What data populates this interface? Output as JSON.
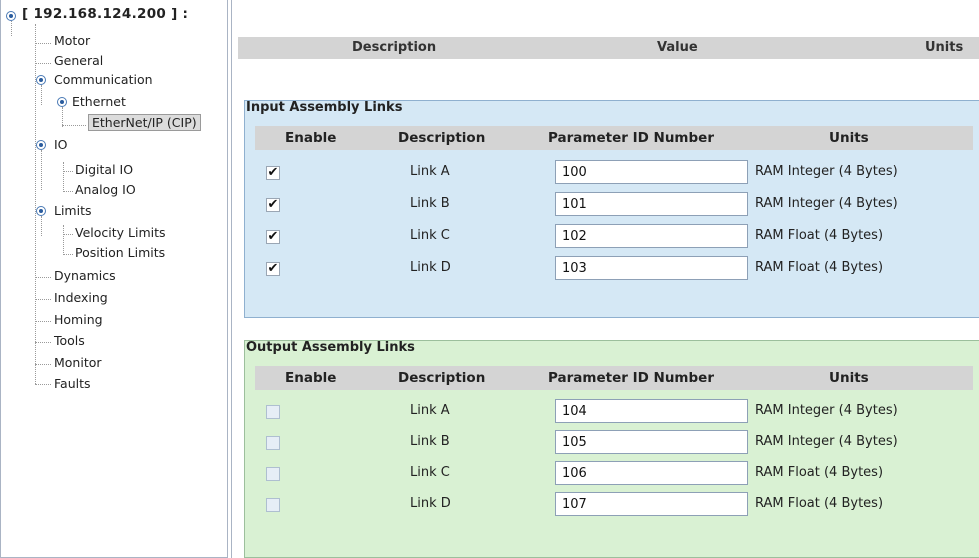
{
  "tree": {
    "root_label": "[ 192.168.124.200 ]  :",
    "items": [
      {
        "label": "Motor"
      },
      {
        "label": "General"
      },
      {
        "label": "Communication"
      },
      {
        "label": "Ethernet"
      },
      {
        "label": "EtherNet/IP (CIP)"
      },
      {
        "label": "IO"
      },
      {
        "label": "Digital IO"
      },
      {
        "label": "Analog IO"
      },
      {
        "label": "Limits"
      },
      {
        "label": "Velocity Limits"
      },
      {
        "label": "Position Limits"
      },
      {
        "label": "Dynamics"
      },
      {
        "label": "Indexing"
      },
      {
        "label": "Homing"
      },
      {
        "label": "Tools"
      },
      {
        "label": "Monitor"
      },
      {
        "label": "Faults"
      }
    ]
  },
  "main": {
    "header": {
      "description": "Description",
      "value": "Value",
      "units": "Units"
    },
    "input_panel": {
      "title": "Input Assembly Links",
      "columns": {
        "enable": "Enable",
        "description": "Description",
        "param": "Parameter ID Number",
        "units": "Units"
      },
      "rows": [
        {
          "enabled": true,
          "check": "✔",
          "description": "Link A",
          "param_id": "100",
          "units": "RAM Integer (4 Bytes)"
        },
        {
          "enabled": true,
          "check": "✔",
          "description": "Link B",
          "param_id": "101",
          "units": "RAM Integer (4 Bytes)"
        },
        {
          "enabled": true,
          "check": "✔",
          "description": "Link C",
          "param_id": "102",
          "units": "RAM Float (4 Bytes)"
        },
        {
          "enabled": true,
          "check": "✔",
          "description": "Link D",
          "param_id": "103",
          "units": "RAM Float (4 Bytes)"
        }
      ]
    },
    "output_panel": {
      "title": "Output Assembly Links",
      "columns": {
        "enable": "Enable",
        "description": "Description",
        "param": "Parameter ID Number",
        "units": "Units"
      },
      "rows": [
        {
          "enabled": false,
          "check": "",
          "description": "Link A",
          "param_id": "104",
          "units": "RAM Integer (4 Bytes)"
        },
        {
          "enabled": false,
          "check": "",
          "description": "Link B",
          "param_id": "105",
          "units": "RAM Integer (4 Bytes)"
        },
        {
          "enabled": false,
          "check": "",
          "description": "Link C",
          "param_id": "106",
          "units": "RAM Float (4 Bytes)"
        },
        {
          "enabled": false,
          "check": "",
          "description": "Link D",
          "param_id": "107",
          "units": "RAM Float (4 Bytes)"
        }
      ]
    }
  },
  "colors": {
    "input_bg": "#d5e8f5",
    "output_bg": "#d9f1d3",
    "header_bg": "#d4d4d4"
  }
}
